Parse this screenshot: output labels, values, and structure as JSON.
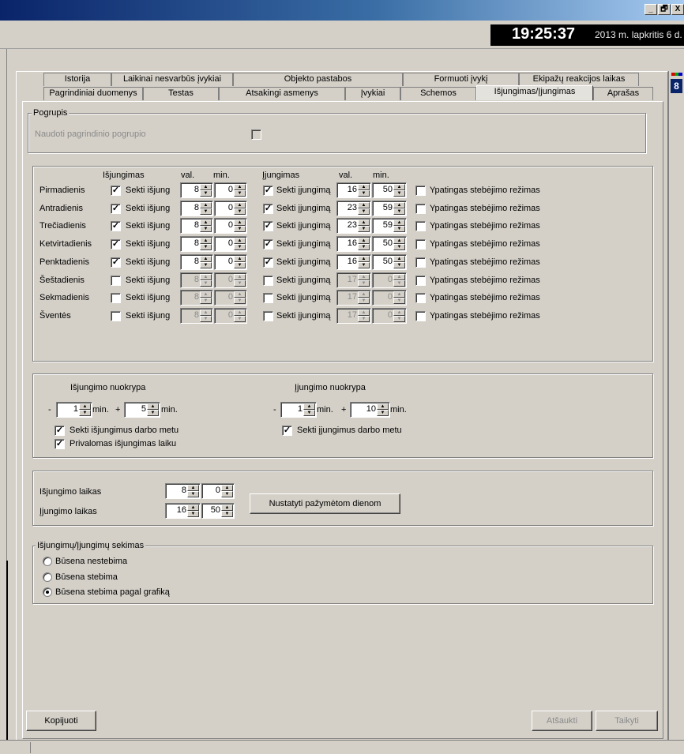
{
  "window": {
    "minimize": "_",
    "restore": "🗗",
    "close": "X"
  },
  "clock": {
    "time": "19:25:37",
    "date": "2013 m. lapkritis 6 d."
  },
  "tabs_row1": [
    "Istorija",
    "Laikinai nesvarbūs įvykiai",
    "Objekto pastabos",
    "Formuoti įvykį",
    "Ekipažų reakcijos laikas"
  ],
  "tabs_row2": [
    "Pagrindiniai duomenys",
    "Testas",
    "Atsakingi asmenys",
    "Įvykiai",
    "Schemos",
    "Išjungimas/Įjungimas",
    "Aprašas"
  ],
  "right_glyph": "8",
  "pogrupis": {
    "title": "Pogrupis",
    "label": "Naudoti pagrindinio pogrupio",
    "checked": false
  },
  "schedule": {
    "headers": {
      "off": "Išjungimas",
      "val1": "val.",
      "min1": "min.",
      "on": "Įjungimas",
      "val2": "val.",
      "min2": "min."
    },
    "off_label": "Sekti išjung",
    "on_label": "Sekti įjungimą",
    "special_label": "Ypatingas stebėjimo režimas",
    "rows": [
      {
        "day": "Pirmadienis",
        "off_checked": true,
        "off_h": "8",
        "off_m": "0",
        "on_checked": true,
        "on_h": "16",
        "on_m": "50",
        "special": false,
        "enabled": true
      },
      {
        "day": "Antradienis",
        "off_checked": true,
        "off_h": "8",
        "off_m": "0",
        "on_checked": true,
        "on_h": "23",
        "on_m": "59",
        "special": false,
        "enabled": true
      },
      {
        "day": "Trečiadienis",
        "off_checked": true,
        "off_h": "8",
        "off_m": "0",
        "on_checked": true,
        "on_h": "23",
        "on_m": "59",
        "special": false,
        "enabled": true
      },
      {
        "day": "Ketvirtadienis",
        "off_checked": true,
        "off_h": "8",
        "off_m": "0",
        "on_checked": true,
        "on_h": "16",
        "on_m": "50",
        "special": false,
        "enabled": true
      },
      {
        "day": "Penktadienis",
        "off_checked": true,
        "off_h": "8",
        "off_m": "0",
        "on_checked": true,
        "on_h": "16",
        "on_m": "50",
        "special": false,
        "enabled": true
      },
      {
        "day": "Šeštadienis",
        "off_checked": false,
        "off_h": "8",
        "off_m": "0",
        "on_checked": false,
        "on_h": "17",
        "on_m": "0",
        "special": false,
        "enabled": false
      },
      {
        "day": "Sekmadienis",
        "off_checked": false,
        "off_h": "8",
        "off_m": "0",
        "on_checked": false,
        "on_h": "17",
        "on_m": "0",
        "special": false,
        "enabled": false
      },
      {
        "day": "Šventės",
        "off_checked": false,
        "off_h": "8",
        "off_m": "0",
        "on_checked": false,
        "on_h": "17",
        "on_m": "0",
        "special": false,
        "enabled": false
      }
    ]
  },
  "deviation": {
    "off_title": "Išjungimo nuokrypa",
    "on_title": "Įjungimo nuokrypa",
    "minus": "-",
    "plus": "+",
    "min_label": "min.",
    "off_minus": "1",
    "off_plus": "5",
    "on_minus": "1",
    "on_plus": "10",
    "off_track_label": "Sekti išjungimus darbo metu",
    "off_required_label": "Privalomas išjungimas laiku",
    "on_track_label": "Sekti įjungimus darbo metu"
  },
  "times": {
    "off_label": "Išjungimo laikas",
    "off_h": "8",
    "off_m": "0",
    "on_label": "Įjungimo laikas",
    "on_h": "16",
    "on_m": "50",
    "apply_button": "Nustatyti pažymėtom dienom"
  },
  "tracking": {
    "title": "Išjungimų/Įjungimų sekimas",
    "options": [
      "Būsena nestebima",
      "Būsena stebima",
      "Būsena stebima pagal grafiką"
    ],
    "selected": 2
  },
  "footer": {
    "copy": "Kopijuoti",
    "cancel": "Atšaukti",
    "apply": "Taikyti"
  },
  "colors": {
    "face": "#d4d0c8",
    "titlebar": "#0a246a",
    "disabled": "#8a8a8a"
  }
}
